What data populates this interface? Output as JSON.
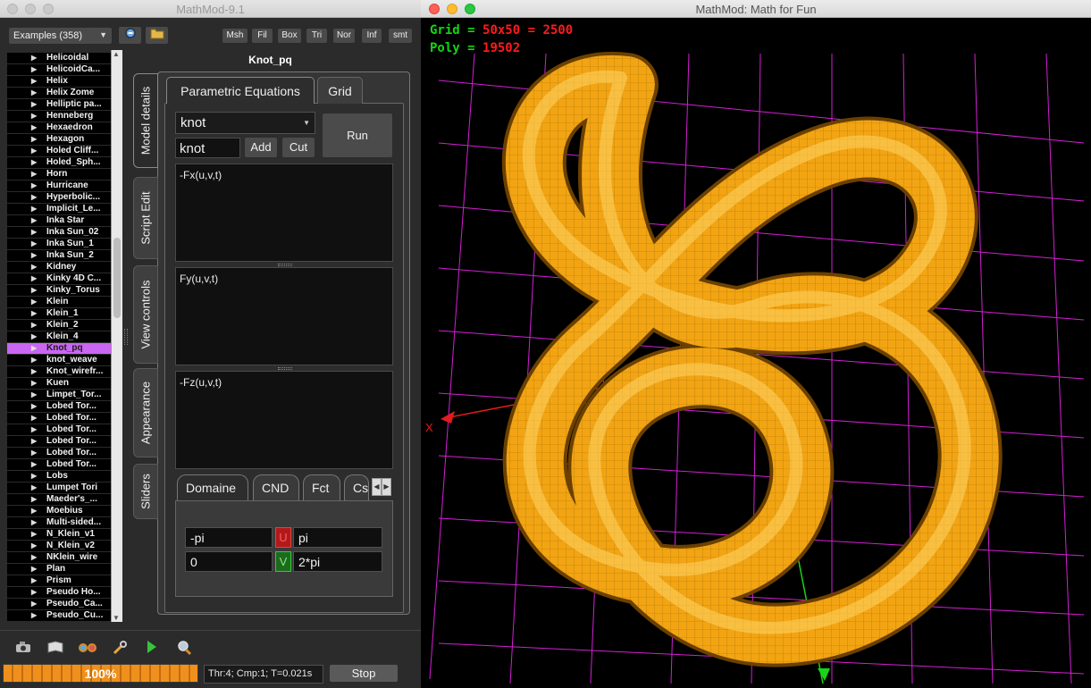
{
  "left_window": {
    "title": "MathMod-9.1",
    "examples_combo": "Examples (358)",
    "toolbar_buttons": [
      "Msh",
      "Fil",
      "Box",
      "Tri",
      "Nor",
      "Inf",
      "smt"
    ],
    "models": [
      "Helicoidal",
      "HelicoidCa...",
      "Helix",
      "Helix Zome",
      "Helliptic pa...",
      "Henneberg",
      "Hexaedron",
      "Hexagon",
      "Holed Cliff...",
      "Holed_Sph...",
      "Horn",
      "Hurricane",
      "Hyperbolic...",
      "Implicit_Le...",
      "Inka Star",
      "Inka Sun_02",
      "Inka Sun_1",
      "Inka Sun_2",
      "Kidney",
      "Kinky 4D C...",
      "Kinky_Torus",
      "Klein",
      "Klein_1",
      "Klein_2",
      "Klein_4",
      "Knot_pq",
      "knot_weave",
      "Knot_wirefr...",
      "Kuen",
      "Limpet_Tor...",
      "Lobed Tor...",
      "Lobed Tor...",
      "Lobed Tor...",
      "Lobed Tor...",
      "Lobed Tor...",
      "Lobed Tor...",
      "Lobs",
      "Lumpet Tori",
      "Maeder's_...",
      "Moebius",
      "Multi-sided...",
      "N_Klein_v1",
      "N_Klein_v2",
      "NKlein_wire",
      "Plan",
      "Prism",
      "Pseudo Ho...",
      "Pseudo_Ca...",
      "Pseudo_Cu..."
    ],
    "selected_model_index": 25,
    "panel_title": "Knot_pq",
    "side_tabs": [
      "Model details",
      "Script Edit",
      "View controls",
      "Appearance",
      "Sliders"
    ],
    "top_tabs": [
      "Parametric Equations",
      "Grid"
    ],
    "name_combo": "knot",
    "name_input": "knot",
    "add_label": "Add",
    "cut_label": "Cut",
    "run_label": "Run",
    "fx": "-Fx(u,v,t)",
    "fy": "Fy(u,v,t)",
    "fz": "-Fz(u,v,t)",
    "sub_tabs": [
      "Domaine",
      "CND",
      "Fct",
      "Cs"
    ],
    "domain": {
      "u_min": "-pi",
      "u_label": "U",
      "u_max": "pi",
      "v_min": "0",
      "v_label": "V",
      "v_max": "2*pi"
    },
    "progress_percent": 100,
    "progress_label": "100%",
    "status_text": "Thr:4; Cmp:1; T=0.021s",
    "stop_label": "Stop",
    "bottom_icons": [
      "camera-icon",
      "book-icon",
      "glasses-icon",
      "wrench-icon",
      "play-icon",
      "magnifier-icon"
    ]
  },
  "right_window": {
    "title": "MathMod: Math for Fun",
    "grid_label": "Grid",
    "grid_value": "50x50 = 2500",
    "poly_label": "Poly",
    "poly_value": "19502",
    "axis_x": "X",
    "axis_z": "Z",
    "colors": {
      "surface": "#f2a413",
      "grid": "#d41fd4",
      "stats_label": "#12d612",
      "stats_value": "#ff1a1a"
    }
  }
}
